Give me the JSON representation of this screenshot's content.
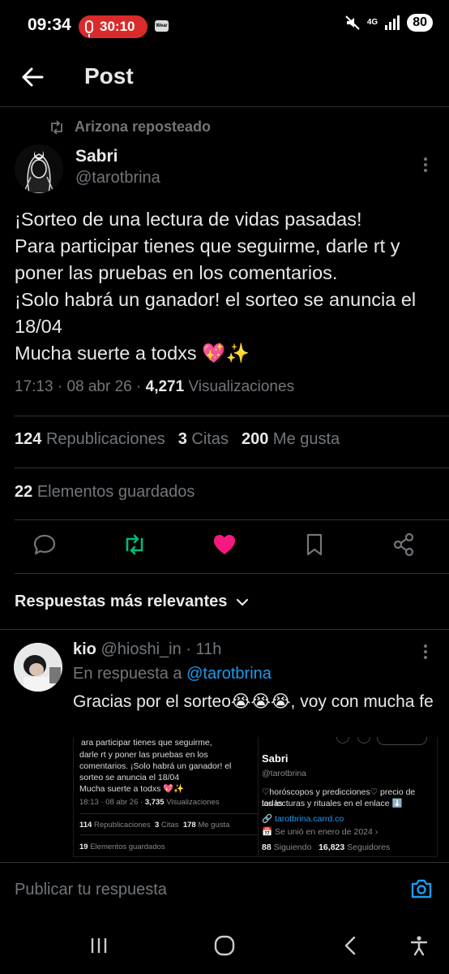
{
  "status_bar": {
    "time": "09:34",
    "recording_timer": "30:10",
    "wear_label": "Wear",
    "network": "4G",
    "battery": "80"
  },
  "header": {
    "title": "Post"
  },
  "repost": {
    "label": "Arizona reposteado"
  },
  "post": {
    "author_name": "Sabri",
    "author_handle": "@tarotbrina",
    "text": "¡Sorteo de una lectura de vidas pasadas!\nPara participar tienes que seguirme, darle rt y poner las pruebas en los comentarios.\n¡Solo habrá un ganador! el sorteo se anuncia el 18/04\nMucha suerte a todxs 💖✨",
    "time": "17:13",
    "date": "08 abr 26",
    "views": "4,271",
    "views_label": "Visualizaciones",
    "reposts": "124",
    "reposts_label": "Republicaciones",
    "quotes": "3",
    "quotes_label": "Citas",
    "likes": "200",
    "likes_label": "Me gusta",
    "saves": "22",
    "saves_label": "Elementos guardados"
  },
  "actions": {
    "reply_icon": "reply-icon",
    "repost_icon": "repost-icon",
    "like_icon": "heart-icon",
    "bookmark_icon": "bookmark-icon",
    "share_icon": "share-icon",
    "repost_color": "#00ba7c",
    "like_color": "#f91880"
  },
  "sort": {
    "label": "Respuestas más relevantes"
  },
  "reply": {
    "name": "kio",
    "handle": "@hioshi_in",
    "time": "11h",
    "in_reply_prefix": "En respuesta a",
    "in_reply_mention": "@tarotbrina",
    "text": "Gracias por el sorteo😭😭😭, voy con mucha fe",
    "attachment_left": {
      "line1": "ara participar tienes que seguirme,",
      "line2": "darle rt y poner las pruebas en los",
      "line3": "comentarios. ¡Solo habrá un ganador! el",
      "line4": "sorteo se anuncia el 18/04",
      "line5": "Mucha suerte a todxs 💖✨",
      "meta_prefix": "18:13 · 08 abr 26 ·",
      "meta_views": "3,735",
      "meta_views_label": "Visualizaciones",
      "reposts": "114",
      "reposts_label": "Republicaciones",
      "quotes": "3",
      "quotes_label": "Citas",
      "likes": "178",
      "likes_label": "Me gusta",
      "saves": "19",
      "saves_label": "Elementos guardados"
    },
    "attachment_right": {
      "name": "Sabri",
      "handle": "@tarotbrina",
      "bio1": "♡horóscopos y predicciones♡ precio de todas",
      "bio2": "las lecturas y rituales en el enlace ⬇️",
      "link": "tarotbrina.carrd.co",
      "joined": "Se unió en enero de 2024",
      "following": "88",
      "following_label": "Siguiendo",
      "followers": "16,823",
      "followers_label": "Seguidores"
    }
  },
  "compose": {
    "placeholder": "Publicar tu respuesta"
  },
  "colors": {
    "accent": "#1d9bf0",
    "muted": "#71767b",
    "text": "#e7e9ea",
    "background": "#000000"
  }
}
